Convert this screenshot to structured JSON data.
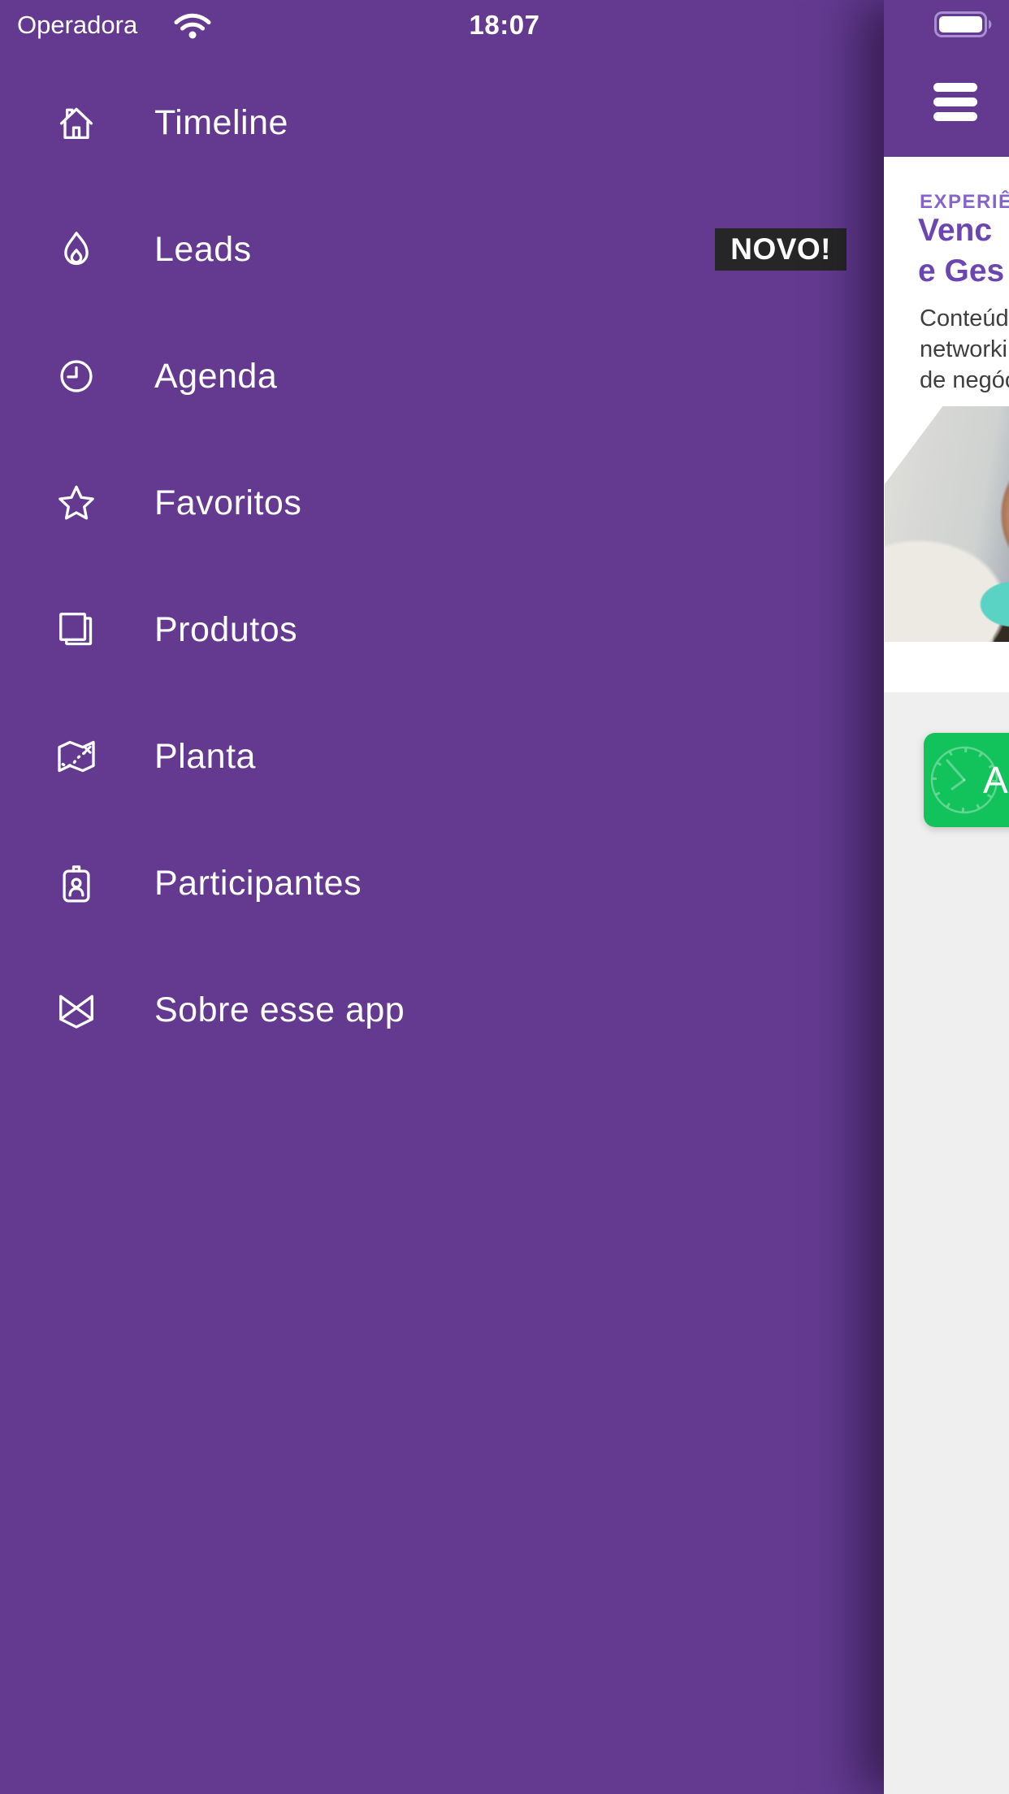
{
  "status_bar": {
    "carrier": "Operadora",
    "time": "18:07"
  },
  "drawer": {
    "items": [
      {
        "label": "Timeline",
        "icon": "home"
      },
      {
        "label": "Leads",
        "icon": "flame",
        "badge": "NOVO!"
      },
      {
        "label": "Agenda",
        "icon": "clock"
      },
      {
        "label": "Favoritos",
        "icon": "star"
      },
      {
        "label": "Produtos",
        "icon": "copy"
      },
      {
        "label": "Planta",
        "icon": "map"
      },
      {
        "label": "Participantes",
        "icon": "id-badge"
      },
      {
        "label": "Sobre esse app",
        "icon": "app-logo"
      }
    ]
  },
  "content": {
    "banner": {
      "eyebrow": "EXPERIÊN",
      "title_line1": "Venc",
      "title_line2": "e Ges",
      "body_line1": "Conteúd",
      "body_line2": "networki",
      "body_line3": "de negóc"
    },
    "agenda_card": {
      "label": "Agenda"
    }
  },
  "colors": {
    "drawer_purple": "#633a90",
    "badge_bg": "#262626",
    "eyebrow_purple": "#8565cb",
    "title_purple": "#6b46b2",
    "body_text": "#3e3e3e",
    "card_green": "#12c35c",
    "content_gray": "#efefef"
  }
}
